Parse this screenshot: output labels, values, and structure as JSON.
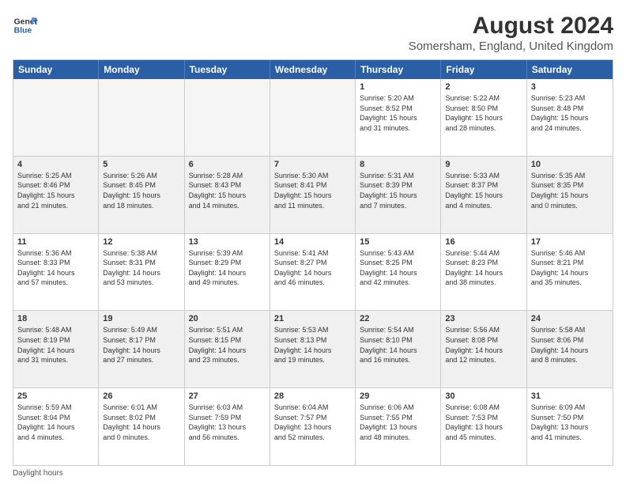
{
  "logo": {
    "line1": "General",
    "line2": "Blue"
  },
  "title": "August 2024",
  "subtitle": "Somersham, England, United Kingdom",
  "days_of_week": [
    "Sunday",
    "Monday",
    "Tuesday",
    "Wednesday",
    "Thursday",
    "Friday",
    "Saturday"
  ],
  "weeks": [
    [
      {
        "day": "",
        "info": "",
        "empty": true
      },
      {
        "day": "",
        "info": "",
        "empty": true
      },
      {
        "day": "",
        "info": "",
        "empty": true
      },
      {
        "day": "",
        "info": "",
        "empty": true
      },
      {
        "day": "1",
        "info": "Sunrise: 5:20 AM\nSunset: 8:52 PM\nDaylight: 15 hours\nand 31 minutes.",
        "empty": false
      },
      {
        "day": "2",
        "info": "Sunrise: 5:22 AM\nSunset: 8:50 PM\nDaylight: 15 hours\nand 28 minutes.",
        "empty": false
      },
      {
        "day": "3",
        "info": "Sunrise: 5:23 AM\nSunset: 8:48 PM\nDaylight: 15 hours\nand 24 minutes.",
        "empty": false
      }
    ],
    [
      {
        "day": "4",
        "info": "Sunrise: 5:25 AM\nSunset: 8:46 PM\nDaylight: 15 hours\nand 21 minutes.",
        "empty": false
      },
      {
        "day": "5",
        "info": "Sunrise: 5:26 AM\nSunset: 8:45 PM\nDaylight: 15 hours\nand 18 minutes.",
        "empty": false
      },
      {
        "day": "6",
        "info": "Sunrise: 5:28 AM\nSunset: 8:43 PM\nDaylight: 15 hours\nand 14 minutes.",
        "empty": false
      },
      {
        "day": "7",
        "info": "Sunrise: 5:30 AM\nSunset: 8:41 PM\nDaylight: 15 hours\nand 11 minutes.",
        "empty": false
      },
      {
        "day": "8",
        "info": "Sunrise: 5:31 AM\nSunset: 8:39 PM\nDaylight: 15 hours\nand 7 minutes.",
        "empty": false
      },
      {
        "day": "9",
        "info": "Sunrise: 5:33 AM\nSunset: 8:37 PM\nDaylight: 15 hours\nand 4 minutes.",
        "empty": false
      },
      {
        "day": "10",
        "info": "Sunrise: 5:35 AM\nSunset: 8:35 PM\nDaylight: 15 hours\nand 0 minutes.",
        "empty": false
      }
    ],
    [
      {
        "day": "11",
        "info": "Sunrise: 5:36 AM\nSunset: 8:33 PM\nDaylight: 14 hours\nand 57 minutes.",
        "empty": false
      },
      {
        "day": "12",
        "info": "Sunrise: 5:38 AM\nSunset: 8:31 PM\nDaylight: 14 hours\nand 53 minutes.",
        "empty": false
      },
      {
        "day": "13",
        "info": "Sunrise: 5:39 AM\nSunset: 8:29 PM\nDaylight: 14 hours\nand 49 minutes.",
        "empty": false
      },
      {
        "day": "14",
        "info": "Sunrise: 5:41 AM\nSunset: 8:27 PM\nDaylight: 14 hours\nand 46 minutes.",
        "empty": false
      },
      {
        "day": "15",
        "info": "Sunrise: 5:43 AM\nSunset: 8:25 PM\nDaylight: 14 hours\nand 42 minutes.",
        "empty": false
      },
      {
        "day": "16",
        "info": "Sunrise: 5:44 AM\nSunset: 8:23 PM\nDaylight: 14 hours\nand 38 minutes.",
        "empty": false
      },
      {
        "day": "17",
        "info": "Sunrise: 5:46 AM\nSunset: 8:21 PM\nDaylight: 14 hours\nand 35 minutes.",
        "empty": false
      }
    ],
    [
      {
        "day": "18",
        "info": "Sunrise: 5:48 AM\nSunset: 8:19 PM\nDaylight: 14 hours\nand 31 minutes.",
        "empty": false
      },
      {
        "day": "19",
        "info": "Sunrise: 5:49 AM\nSunset: 8:17 PM\nDaylight: 14 hours\nand 27 minutes.",
        "empty": false
      },
      {
        "day": "20",
        "info": "Sunrise: 5:51 AM\nSunset: 8:15 PM\nDaylight: 14 hours\nand 23 minutes.",
        "empty": false
      },
      {
        "day": "21",
        "info": "Sunrise: 5:53 AM\nSunset: 8:13 PM\nDaylight: 14 hours\nand 19 minutes.",
        "empty": false
      },
      {
        "day": "22",
        "info": "Sunrise: 5:54 AM\nSunset: 8:10 PM\nDaylight: 14 hours\nand 16 minutes.",
        "empty": false
      },
      {
        "day": "23",
        "info": "Sunrise: 5:56 AM\nSunset: 8:08 PM\nDaylight: 14 hours\nand 12 minutes.",
        "empty": false
      },
      {
        "day": "24",
        "info": "Sunrise: 5:58 AM\nSunset: 8:06 PM\nDaylight: 14 hours\nand 8 minutes.",
        "empty": false
      }
    ],
    [
      {
        "day": "25",
        "info": "Sunrise: 5:59 AM\nSunset: 8:04 PM\nDaylight: 14 hours\nand 4 minutes.",
        "empty": false
      },
      {
        "day": "26",
        "info": "Sunrise: 6:01 AM\nSunset: 8:02 PM\nDaylight: 14 hours\nand 0 minutes.",
        "empty": false
      },
      {
        "day": "27",
        "info": "Sunrise: 6:03 AM\nSunset: 7:59 PM\nDaylight: 13 hours\nand 56 minutes.",
        "empty": false
      },
      {
        "day": "28",
        "info": "Sunrise: 6:04 AM\nSunset: 7:57 PM\nDaylight: 13 hours\nand 52 minutes.",
        "empty": false
      },
      {
        "day": "29",
        "info": "Sunrise: 6:06 AM\nSunset: 7:55 PM\nDaylight: 13 hours\nand 48 minutes.",
        "empty": false
      },
      {
        "day": "30",
        "info": "Sunrise: 6:08 AM\nSunset: 7:53 PM\nDaylight: 13 hours\nand 45 minutes.",
        "empty": false
      },
      {
        "day": "31",
        "info": "Sunrise: 6:09 AM\nSunset: 7:50 PM\nDaylight: 13 hours\nand 41 minutes.",
        "empty": false
      }
    ]
  ],
  "footer": "Daylight hours"
}
